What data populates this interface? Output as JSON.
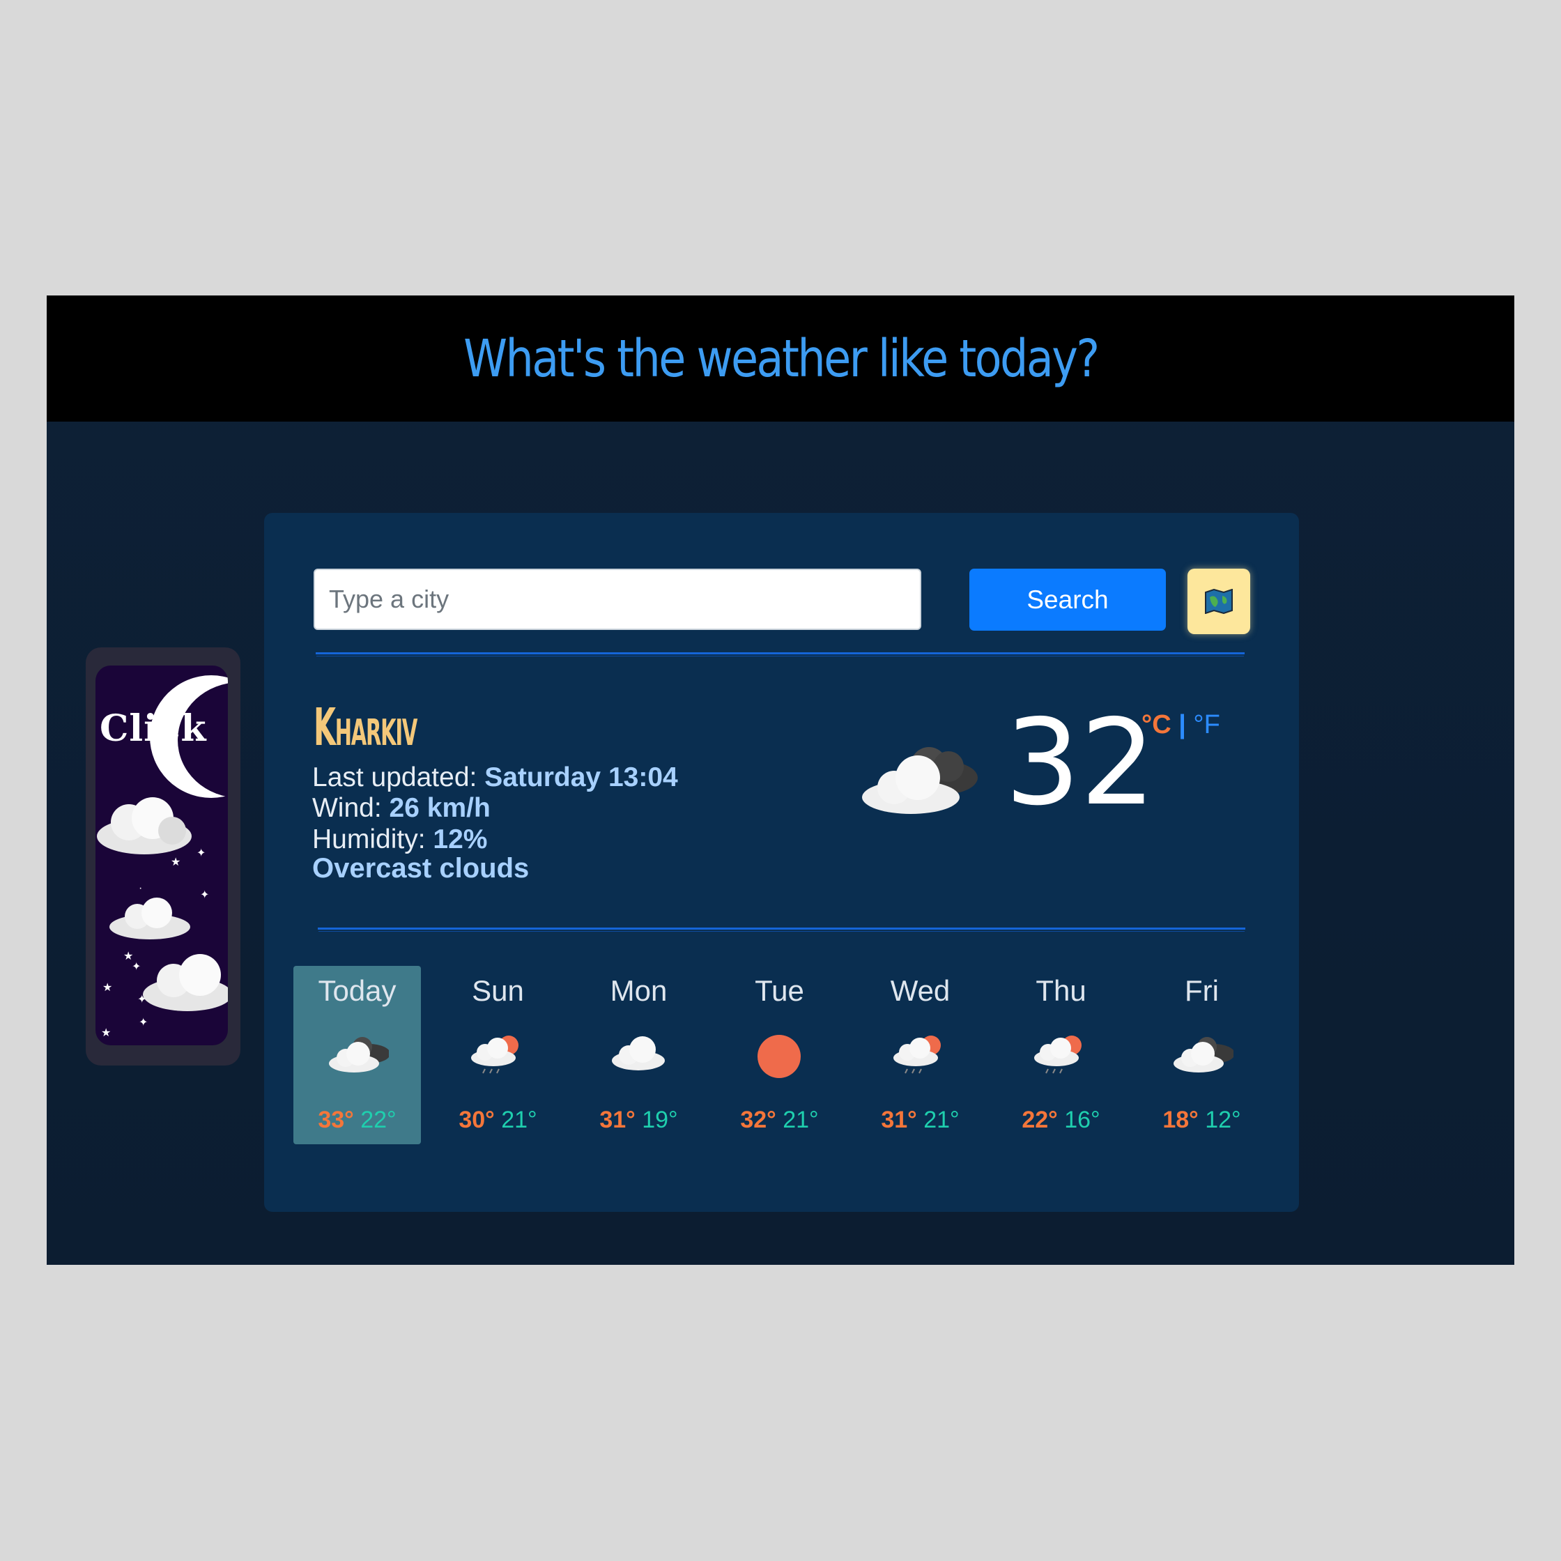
{
  "header": {
    "title": "What's the weather like today?"
  },
  "theme_toggle": {
    "label": "Click"
  },
  "search": {
    "placeholder": "Type a city",
    "button_label": "Search"
  },
  "current": {
    "city": "Kharkiv",
    "last_updated_label": "Last updated:",
    "last_updated_value": "Saturday 13:04",
    "wind_label": "Wind:",
    "wind_value": "26 km/h",
    "humidity_label": "Humidity:",
    "humidity_value": "12%",
    "description": "Overcast clouds",
    "temperature": "32",
    "unit_celsius": "°C",
    "unit_separator": "|",
    "unit_fahrenheit": "°F",
    "icon": "overcast-clouds-icon"
  },
  "forecast": [
    {
      "day": "Today",
      "max": "33°",
      "min": "22°",
      "icon": "overcast-clouds-icon",
      "active": true
    },
    {
      "day": "Sun",
      "max": "30°",
      "min": "21°",
      "icon": "rain-sun-icon"
    },
    {
      "day": "Mon",
      "max": "31°",
      "min": "19°",
      "icon": "cloud-icon"
    },
    {
      "day": "Tue",
      "max": "32°",
      "min": "21°",
      "icon": "sun-icon"
    },
    {
      "day": "Wed",
      "max": "31°",
      "min": "21°",
      "icon": "rain-sun-icon"
    },
    {
      "day": "Thu",
      "max": "22°",
      "min": "16°",
      "icon": "rain-sun-icon"
    },
    {
      "day": "Fri",
      "max": "18°",
      "min": "12°",
      "icon": "overcast-clouds-icon"
    }
  ],
  "colors": {
    "accent": "#3d9cf2",
    "search_button": "#0b7bff",
    "max_temp": "#f4763a",
    "min_temp": "#1fcfae",
    "city": "#f4c87a"
  }
}
